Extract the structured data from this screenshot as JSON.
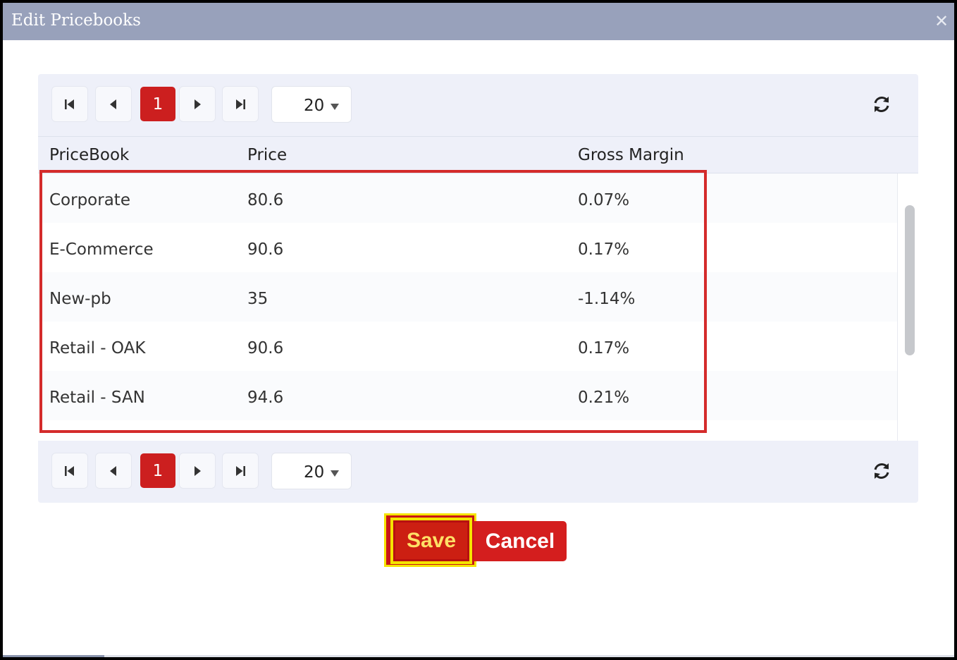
{
  "dialog": {
    "title": "Edit Pricebooks",
    "close_glyph": "✕"
  },
  "pager": {
    "current_page": "1",
    "page_size": "20",
    "icons": [
      "first-page-icon",
      "prev-page-icon",
      "next-page-icon",
      "last-page-icon",
      "refresh-icon"
    ]
  },
  "table": {
    "columns": [
      "PriceBook",
      "Price",
      "Gross Margin"
    ],
    "rows": [
      {
        "pricebook": "Corporate",
        "price": "80.6",
        "margin": "0.07%"
      },
      {
        "pricebook": "E-Commerce",
        "price": "90.6",
        "margin": "0.17%"
      },
      {
        "pricebook": "New-pb",
        "price": "35",
        "margin": "-1.14%"
      },
      {
        "pricebook": "Retail - OAK",
        "price": "90.6",
        "margin": "0.17%"
      },
      {
        "pricebook": "Retail - SAN",
        "price": "94.6",
        "margin": "0.21%"
      }
    ]
  },
  "actions": {
    "save_label": "Save",
    "cancel_label": "Cancel"
  },
  "colors": {
    "titlebar": "#98a1bb",
    "accent_red": "#cc1f1f",
    "highlight_yellow": "#f5e400",
    "grid_bg": "#eef0f9"
  }
}
